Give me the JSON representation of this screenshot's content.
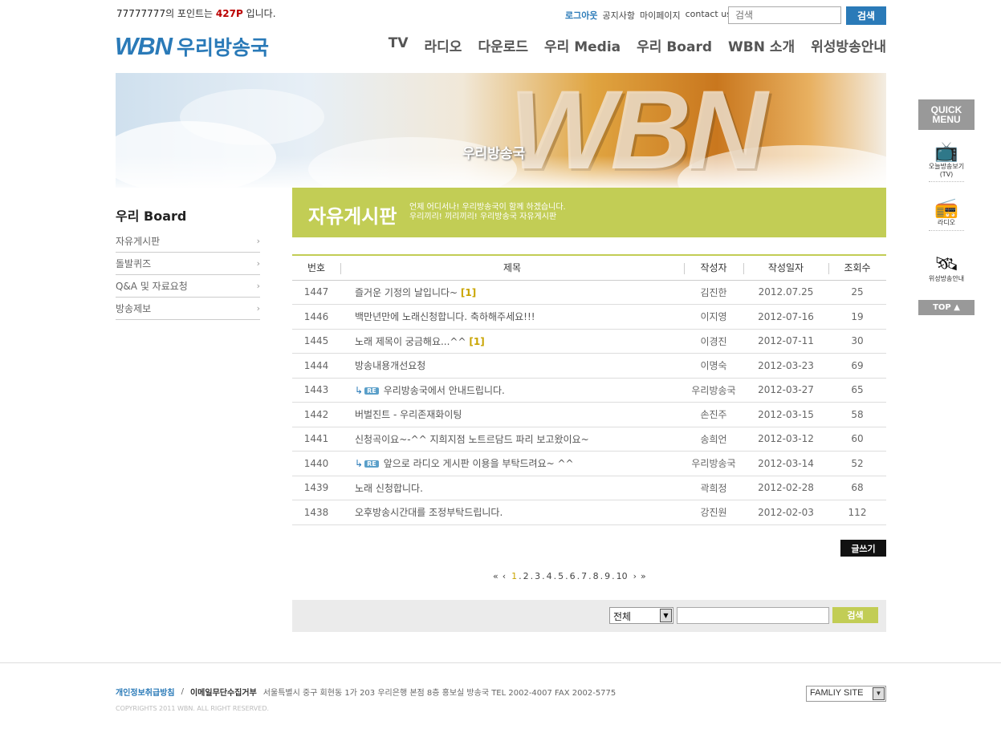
{
  "top": {
    "user_id": "77777777",
    "points_prefix": "의 포인트는 ",
    "points_value": "427P",
    "points_suffix": " 입니다.",
    "util_links": [
      "로그아웃",
      "공지사항",
      "마이페이지",
      "contact us"
    ],
    "search_placeholder": "검색",
    "search_button": "검색"
  },
  "logo": {
    "mark": "WBN",
    "name": "우리방송국"
  },
  "nav": [
    "TV",
    "라디오",
    "다운로드",
    "우리 Media",
    "우리 Board",
    "WBN 소개",
    "위성방송안내"
  ],
  "banner": {
    "big_text": "WBN",
    "sub_text": "우리방송국"
  },
  "sidebar": {
    "title": "우리 Board",
    "items": [
      {
        "label": "자유게시판"
      },
      {
        "label": "돌발퀴즈"
      },
      {
        "label": "Q&A 및 자료요청"
      },
      {
        "label": "방송제보"
      }
    ]
  },
  "board_header": {
    "title": "자유게시판",
    "desc_line1": "언제 어디서나! 우리방송국이 함께 하겠습니다.",
    "desc_line2": "우리끼리! 끼리끼리! 우리방송국 자유게시판"
  },
  "table": {
    "columns": [
      "번호",
      "제목",
      "작성자",
      "작성일자",
      "조회수"
    ],
    "rows": [
      {
        "no": "1447",
        "subject": "즐거운 기정의 날입니다~",
        "comments": "[1]",
        "reply": false,
        "author": "김진한",
        "date": "2012.07.25",
        "views": "25"
      },
      {
        "no": "1446",
        "subject": "백만년만에 노래신청합니다. 축하해주세요!!!",
        "comments": "",
        "reply": false,
        "author": "이지영",
        "date": "2012-07-16",
        "views": "19"
      },
      {
        "no": "1445",
        "subject": "노래 제목이 궁금해요...^^",
        "comments": "[1]",
        "reply": false,
        "author": "이경진",
        "date": "2012-07-11",
        "views": "30"
      },
      {
        "no": "1444",
        "subject": "방송내용개선요청",
        "comments": "",
        "reply": false,
        "author": "이명숙",
        "date": "2012-03-23",
        "views": "69"
      },
      {
        "no": "1443",
        "subject": "우리방송국에서 안내드립니다.",
        "comments": "",
        "reply": true,
        "author": "우리방송국",
        "date": "2012-03-27",
        "views": "65"
      },
      {
        "no": "1442",
        "subject": "버벌진트 - 우리존재화이팅",
        "comments": "",
        "reply": false,
        "author": "손진주",
        "date": "2012-03-15",
        "views": "58"
      },
      {
        "no": "1441",
        "subject": "신청곡이요~-^^ 지희지점 노트르담드 파리 보고왔이요~",
        "comments": "",
        "reply": false,
        "author": "송희언",
        "date": "2012-03-12",
        "views": "60"
      },
      {
        "no": "1440",
        "subject": "앞으로 라디오 게시판 이용을 부탁드려요~ ^^",
        "comments": "",
        "reply": true,
        "author": "우리방송국",
        "date": "2012-03-14",
        "views": "52"
      },
      {
        "no": "1439",
        "subject": "노래 신청합니다.",
        "comments": "",
        "reply": false,
        "author": "곽희정",
        "date": "2012-02-28",
        "views": "68"
      },
      {
        "no": "1438",
        "subject": "오후방송시간대를 조정부탁드립니다.",
        "comments": "",
        "reply": false,
        "author": "강진원",
        "date": "2012-02-03",
        "views": "112"
      }
    ],
    "re_badge": "RE"
  },
  "write_button": "글쓰기",
  "paging": {
    "first": "«",
    "prev": "‹",
    "pages": [
      "1",
      "2",
      "3",
      "4",
      "5",
      "6",
      "7",
      "8",
      "9",
      "10"
    ],
    "current": "1",
    "next": "›",
    "last": "»"
  },
  "search": {
    "select_value": "전체",
    "button": "검색"
  },
  "quick_menu": {
    "title_line1": "QUICK",
    "title_line2": "MENU",
    "items": [
      {
        "label_line1": "오늘방송보기",
        "label_line2": "(TV)",
        "icon": "tv-icon"
      },
      {
        "label_line1": "라디오",
        "label_line2": "",
        "icon": "radio-icon"
      },
      {
        "label_line1": "위성방송안내",
        "label_line2": "",
        "icon": "satellite-icon"
      }
    ],
    "top_button": "TOP ▲"
  },
  "footer": {
    "privacy": "개인정보취급방침",
    "separator": "/",
    "no_email": "이메일무단수집거부",
    "address": "서울특별시 중구 회현동 1가 203 우리은행 본점 8층 홍보실 방송국  TEL 2002-4007  FAX 2002-5775",
    "copyright": "COPYRIGHTS 2011 WBN. ALL RIGHT RESERVED.",
    "family_site": "FAMLIY SITE"
  }
}
